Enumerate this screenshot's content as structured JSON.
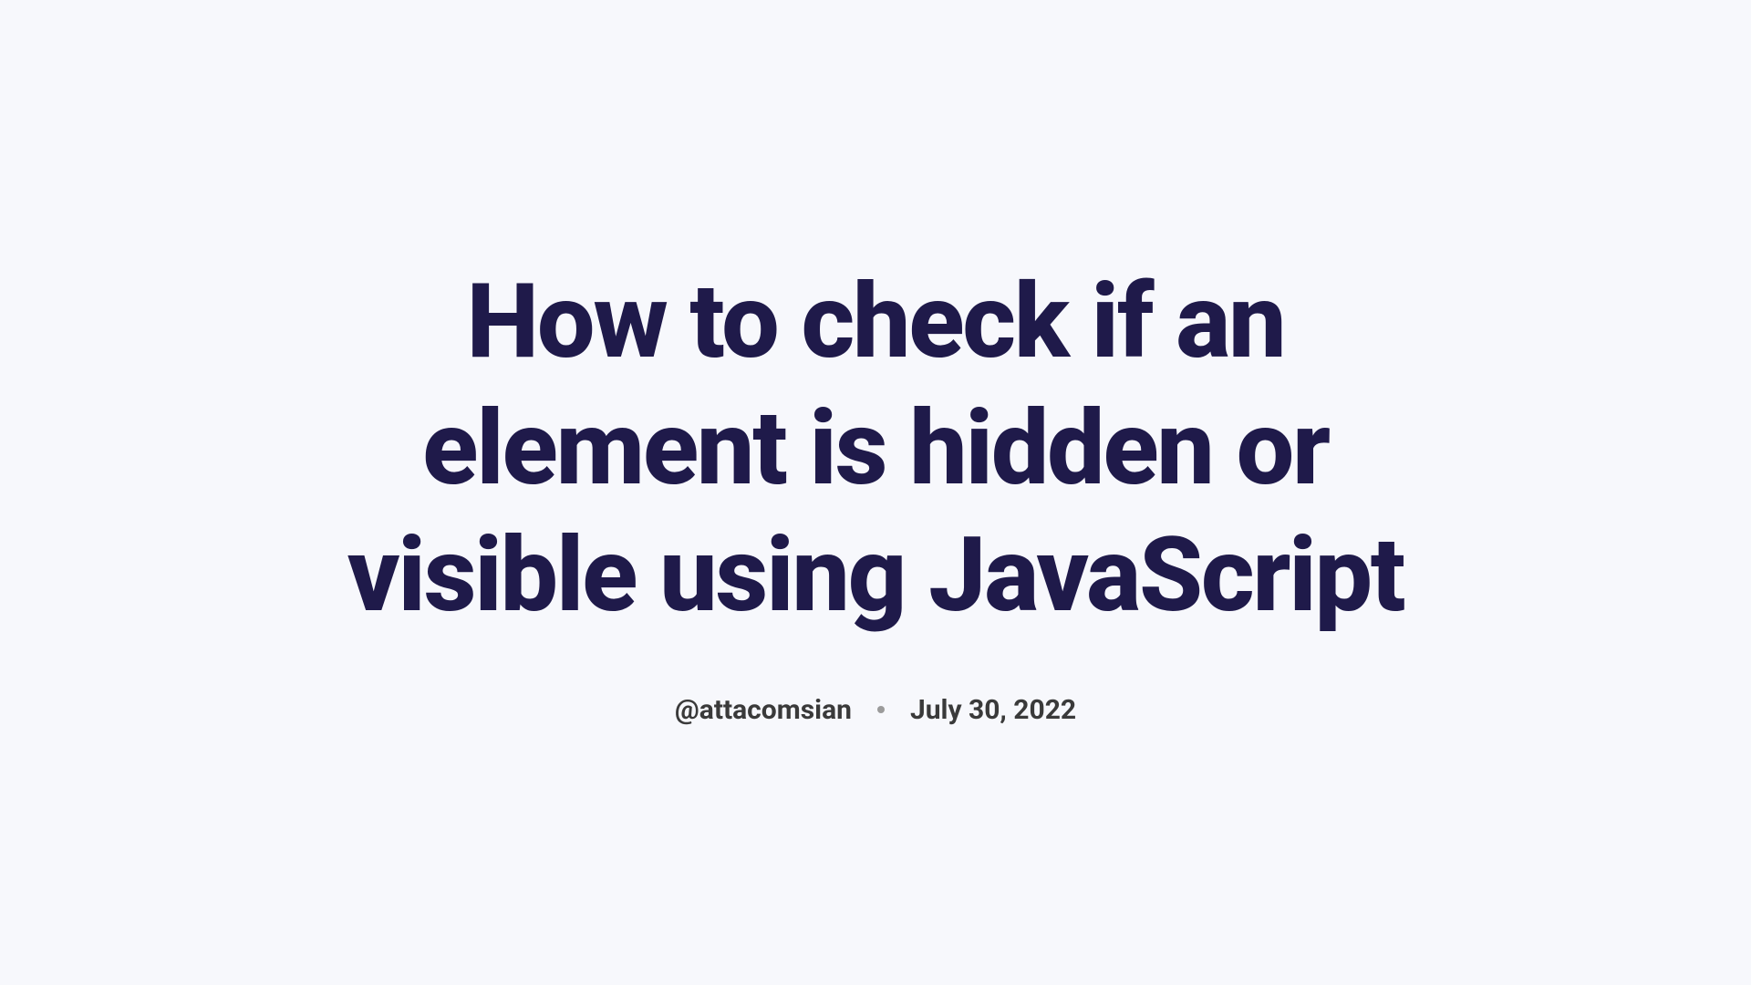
{
  "title": "How to check if an element is hidden or visible using JavaScript",
  "meta": {
    "author": "@attacomsian",
    "date": "July 30, 2022"
  }
}
